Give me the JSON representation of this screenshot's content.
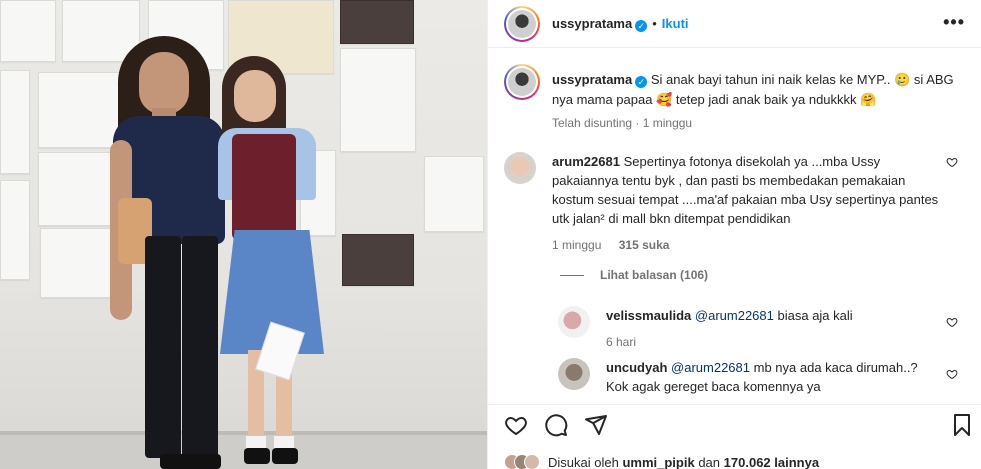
{
  "post": {
    "username": "ussypratama",
    "follow_label": "Ikuti",
    "more_label": "•••",
    "verified_glyph": "✓",
    "separator": "•"
  },
  "caption": {
    "username": "ussypratama",
    "text": "Si anak bayi tahun ini naik kelas ke MYP.. 🥲 si ABG nya mama papaa 🥰 tetep jadi anak baik ya ndukkkk 🤗",
    "meta": "Telah disunting · 1 minggu"
  },
  "comments": [
    {
      "username": "arum22681",
      "text": "Sepertinya fotonya disekolah ya ...mba Ussy pakaiannya tentu byk , dan pasti bs membedakan pemakaian kostum sesuai tempat ....ma'af pakaian mba Usy sepertinya pantes utk jalan² di mall bkn ditempat pendidikan",
      "time": "1 minggu",
      "likes": "315 suka"
    }
  ],
  "view_replies": "Lihat balasan (106)",
  "replies": [
    {
      "username": "velissmaulida",
      "mention": "@arum22681",
      "text": "biasa aja kali",
      "time": "6 hari"
    },
    {
      "username": "uncudyah",
      "mention": "@arum22681",
      "text": "mb nya ada kaca dirumah..? Kok agak gereget baca komennya ya"
    }
  ],
  "liked_by": {
    "prefix": "Disukai oleh",
    "user": "ummi_pipik",
    "middle": "dan",
    "count": "170.062 lainnya"
  },
  "icons": [
    "heart-icon",
    "comment-icon",
    "share-icon",
    "bookmark-icon",
    "more-icon",
    "verified-icon"
  ],
  "colors": {
    "link": "#0095f6",
    "muted": "#737373",
    "text": "#262626"
  }
}
